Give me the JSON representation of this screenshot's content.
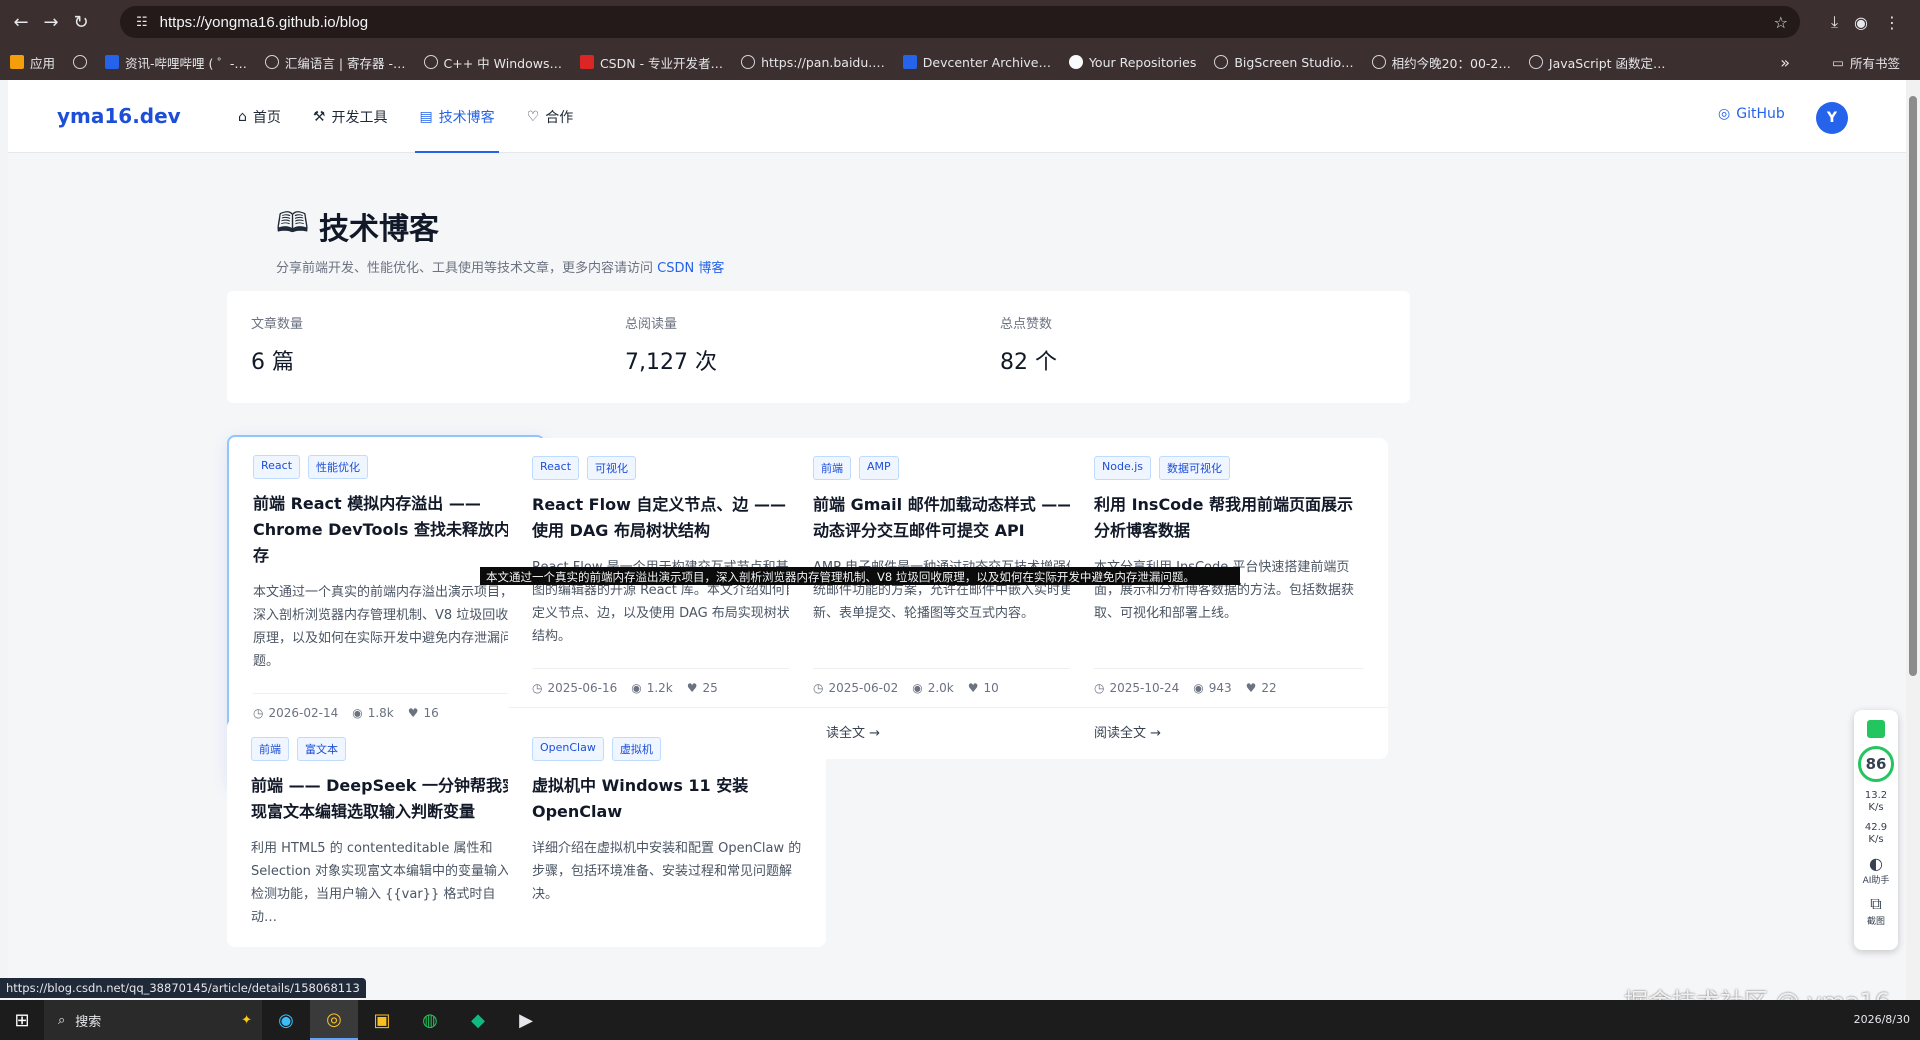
{
  "browser": {
    "url": "https://yongma16.github.io/blog",
    "bookmarks": [
      {
        "label": "应用",
        "icon": "apps-grid-icon"
      },
      {
        "label": "",
        "icon": "grid-icon"
      },
      {
        "label": "资讯-哔哩哔哩 ( ゜-…",
        "icon": "bilibili-icon"
      },
      {
        "label": "汇编语言 | 寄存器 -…",
        "icon": "globe-icon"
      },
      {
        "label": "C++ 中 Windows…",
        "icon": "globe-icon"
      },
      {
        "label": "CSDN - 专业开发者…",
        "icon": "csdn-icon"
      },
      {
        "label": "https://pan.baidu.…",
        "icon": "globe-icon"
      },
      {
        "label": "Devcenter Archive…",
        "icon": "devcenter-icon"
      },
      {
        "label": "Your Repositories",
        "icon": "github-icon"
      },
      {
        "label": "BigScreen Studio…",
        "icon": "globe-icon"
      },
      {
        "label": "相约今晚20：00-2…",
        "icon": "globe-icon"
      },
      {
        "label": "JavaScript 函数定…",
        "icon": "globe-icon"
      }
    ],
    "more": "»",
    "all_bookmarks": "所有书签",
    "status_url": "https://blog.csdn.net/qq_38870145/article/details/158068113"
  },
  "site": {
    "logo": "yma16.dev",
    "nav": [
      {
        "label": "首页",
        "icon": "⌂"
      },
      {
        "label": "开发工具",
        "icon": "⚒"
      },
      {
        "label": "技术博客",
        "icon": "▤"
      },
      {
        "label": "合作",
        "icon": "♡"
      }
    ],
    "github": "GitHub",
    "avatar": "Y"
  },
  "main": {
    "title": "技术博客",
    "subtitle_prefix": "分享前端开发、性能优化、工具使用等技术文章，更多内容请访问",
    "subtitle_link": "CSDN 博客",
    "stats": [
      {
        "label": "文章数量",
        "value": "6 篇"
      },
      {
        "label": "总阅读量",
        "value": "7,127 次"
      },
      {
        "label": "总点赞数",
        "value": "82 个"
      }
    ],
    "read_more": "阅读全文",
    "cards": [
      {
        "tags": [
          "React",
          "性能优化"
        ],
        "title": "前端 React 模拟内存溢出 —— Chrome DevTools 查找未释放内存",
        "desc": "本文通过一个真实的前端内存溢出演示项目，深入剖析浏览器内存管理机制、V8 垃圾回收原理，以及如何在实际开发中避免内存泄漏问题。",
        "date": "2026-02-14",
        "views": "1.8k",
        "likes": "16"
      },
      {
        "tags": [
          "React",
          "可视化"
        ],
        "title": "React Flow 自定义节点、边 —— 使用 DAG 布局树状结构",
        "desc": "React Flow 是一个用于构建交互式节点和基于图的编辑器的开源 React 库。本文介绍如何自定义节点、边，以及使用 DAG 布局实现树状结构。",
        "date": "2025-06-16",
        "views": "1.2k",
        "likes": "25"
      },
      {
        "tags": [
          "前端",
          "AMP"
        ],
        "title": "前端 Gmail 邮件加载动态样式 —— 动态评分交互邮件可提交 API",
        "desc": "AMP 电子邮件是一种通过动态交互技术增强传统邮件功能的方案，允许在邮件中嵌入实时更新、表单提交、轮播图等交互式内容。",
        "date": "2025-06-02",
        "views": "2.0k",
        "likes": "10"
      },
      {
        "tags": [
          "Node.js",
          "数据可视化"
        ],
        "title": "利用 InsCode 帮我用前端页面展示分析博客数据",
        "desc": "本文分享利用 InsCode 平台快速搭建前端页面，展示和分析博客数据的方法。包括数据获取、可视化和部署上线。",
        "date": "2025-10-24",
        "views": "943",
        "likes": "22"
      },
      {
        "tags": [
          "前端",
          "富文本"
        ],
        "title": "前端 —— DeepSeek 一分钟帮我实现富文本编辑选取输入判断变量",
        "desc": "利用 HTML5 的 contenteditable 属性和 Selection 对象实现富文本编辑中的变量输入检测功能，当用户输入 {{var}} 格式时自动…",
        "date": "",
        "views": "",
        "likes": ""
      },
      {
        "tags": [
          "OpenClaw",
          "虚拟机"
        ],
        "title": "虚拟机中 Windows 11 安装 OpenClaw",
        "desc": "详细介绍在虚拟机中安装和配置 OpenClaw 的步骤，包括环境准备、安装过程和常见问题解决。",
        "date": "",
        "views": "",
        "likes": ""
      }
    ],
    "tooltip": "本文通过一个真实的前端内存溢出演示项目，深入剖析浏览器内存管理机制、V8 垃圾回收原理，以及如何在实际开发中避免内存泄漏问题。"
  },
  "widget": {
    "score": "86",
    "up": "13.2",
    "down": "42.9",
    "unit": "K/s",
    "ai": "AI助手",
    "shot": "截图"
  },
  "watermark": "掘金技术社区 @ yma16",
  "taskbar": {
    "search": "搜索",
    "date": "2026/8/30"
  }
}
